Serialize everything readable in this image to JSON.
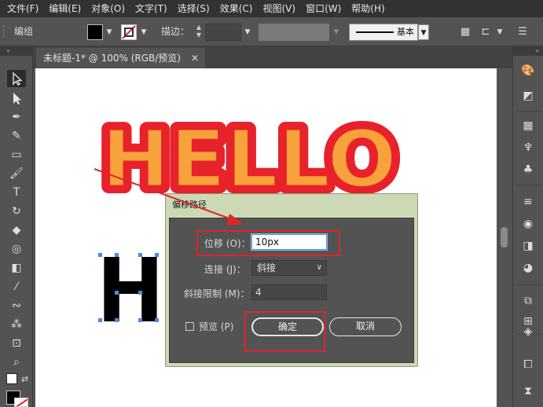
{
  "menubar": {
    "items": [
      "文件(F)",
      "编辑(E)",
      "对象(O)",
      "文字(T)",
      "选择(S)",
      "效果(C)",
      "视图(V)",
      "窗口(W)",
      "帮助(H)"
    ]
  },
  "controlbar": {
    "group_label": "编组",
    "stroke_label": "描边：",
    "stroke_profile": "基本",
    "fill_color": "#000000",
    "stroke_color": "none"
  },
  "document": {
    "tab_title": "未标题-1* @ 100% (RGB/预览)",
    "close_glyph": "✕"
  },
  "artwork": {
    "headline": "HELLO",
    "headline_fill": "#f7a23a",
    "headline_offset_stroke": "#e8222a",
    "small_letter": "H"
  },
  "dialog": {
    "title": "偏移路径",
    "offset_label": "位移 (O)：",
    "offset_value": "10px",
    "join_label": "连接 (J)：",
    "join_value": "斜接",
    "miter_label": "斜接限制 (M)：",
    "miter_value": "4",
    "preview_label": "预览 (P)",
    "preview_checked": false,
    "ok_label": "确定",
    "cancel_label": "取消"
  },
  "colors": {
    "annotation_red": "#e0242a",
    "app_bg": "#535353",
    "menubar_bg": "#323232"
  }
}
